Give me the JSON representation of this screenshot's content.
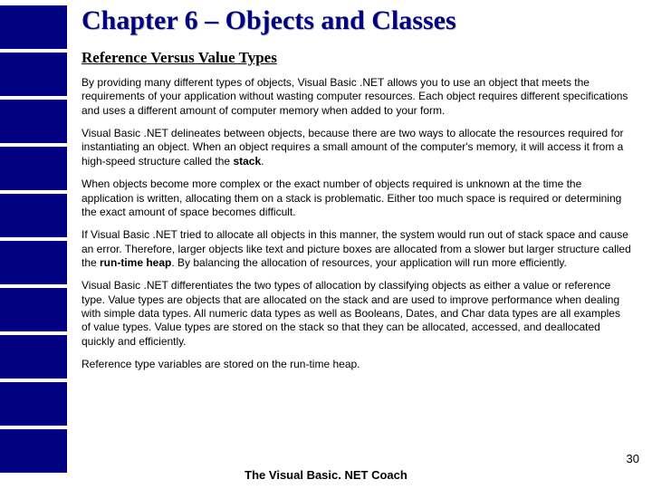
{
  "title": "Chapter 6 – Objects and Classes",
  "subtitle": "Reference Versus Value Types",
  "paragraphs": [
    {
      "text": "By providing many different types of objects, Visual Basic .NET allows you to use an object that meets the requirements of your application without wasting computer resources. Each object requires different specifications and uses a different amount of computer memory when added to your form."
    },
    {
      "pre": "Visual Basic .NET delineates between objects, because there are two ways to allocate the resources required for instantiating an object. When an object requires a small amount of the computer's memory, it will access it from a high-speed structure called the ",
      "bold": "stack",
      "post": "."
    },
    {
      "text": "When objects become more complex or the exact number of objects required is unknown at the time the application is written, allocating them on a stack is problematic. Either too much space is required or determining the exact amount of space becomes difficult."
    },
    {
      "pre": "If Visual Basic .NET tried to allocate all objects in this manner, the system would run out of stack space and cause an error. Therefore, larger objects like text and picture boxes are allocated from a slower but larger structure called the ",
      "bold": "run-time heap",
      "post": ". By balancing the allocation of resources, your application will run more efficiently."
    },
    {
      "text": "Visual Basic .NET differentiates the two types of allocation by classifying objects as either a value or reference type. Value types are objects that are allocated on the stack and are used to improve performance when dealing with simple data types. All numeric data types as well as Booleans, Dates, and Char data types are all examples of value types. Value types are stored on the stack so that they can be allocated, accessed, and deallocated quickly and efficiently."
    },
    {
      "text": "Reference type variables are stored on the run-time heap."
    }
  ],
  "footer": "The Visual Basic. NET Coach",
  "page_number": "30"
}
